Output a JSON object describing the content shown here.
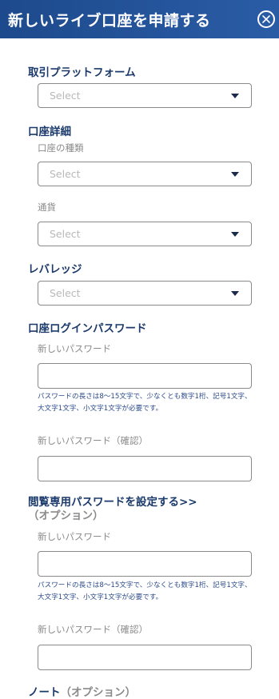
{
  "header": {
    "title": "新しいライブ口座を申請する",
    "close_icon": "close-circle-icon"
  },
  "platform": {
    "title": "取引プラットフォーム",
    "select_value": "Select"
  },
  "account_details": {
    "title": "口座詳細",
    "account_type_label": "口座の種類",
    "account_type_value": "Select",
    "currency_label": "通貨",
    "currency_value": "Select"
  },
  "leverage": {
    "title": "レバレッジ",
    "select_value": "Select"
  },
  "login_password": {
    "title": "口座ログインパスワード",
    "new_password_label": "新しいパスワード",
    "new_password_value": "",
    "hint": "パスワードの長さは8～15文字で、少なくとも数字1桁、記号1文字、大文字1文字、小文字1文字が必要です。",
    "confirm_label": "新しいパスワード（確認）",
    "confirm_value": ""
  },
  "readonly_password": {
    "title": "閲覧専用パスワードを設定する>>",
    "optional": "（オプション）",
    "new_password_label": "新しいパスワード",
    "new_password_value": "",
    "hint": "パスワードの長さは8～15文字で、少なくとも数字1桁、記号1文字、大文字1文字、小文字1文字が必要です。",
    "confirm_label": "新しいパスワード（確認）",
    "confirm_value": ""
  },
  "note": {
    "title": "ノート",
    "optional": "（オプション）"
  },
  "colors": {
    "header_bg": "#1d4a8c",
    "section_title": "#1b3a6b",
    "hint_text": "#2a4a8a",
    "label_gray": "#8a8a8a"
  }
}
